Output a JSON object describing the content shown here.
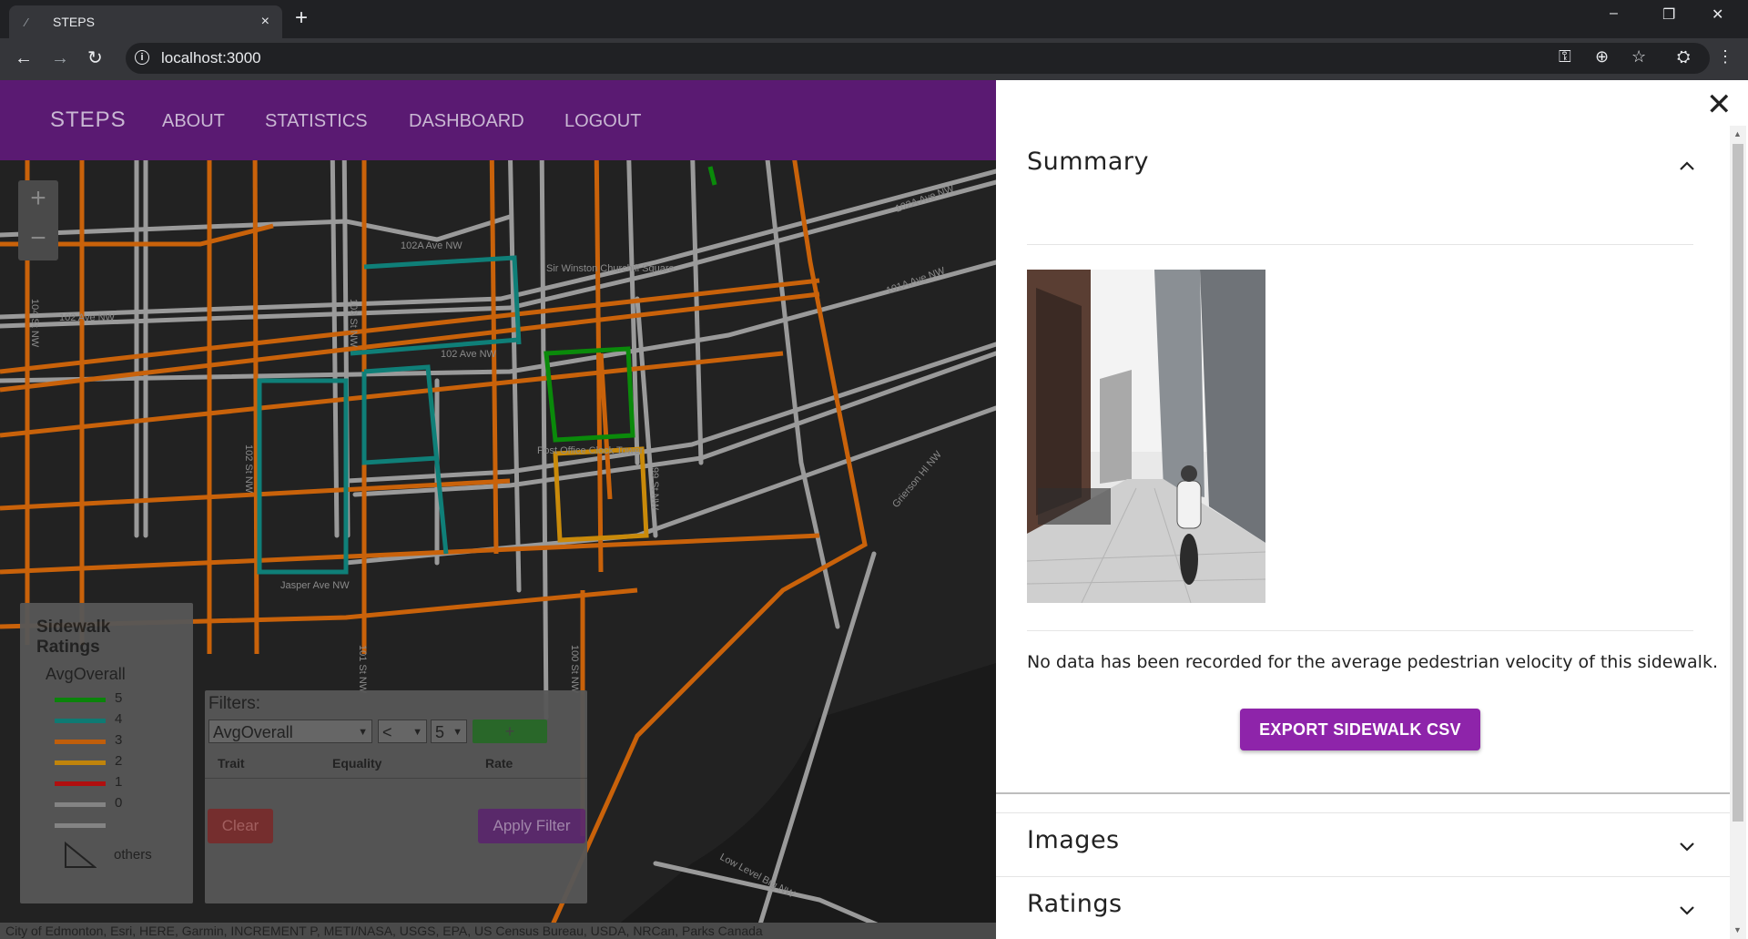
{
  "browser": {
    "tab_title": "STEPS",
    "tab_close": "×",
    "new_tab": "+",
    "url": "localhost:3000",
    "window_controls": {
      "minimize": "–",
      "restore": "❐",
      "close": "✕"
    }
  },
  "app": {
    "brand": "STEPS",
    "nav": [
      "ABOUT",
      "STATISTICS",
      "DASHBOARD",
      "LOGOUT"
    ]
  },
  "map": {
    "zoom_in": "+",
    "zoom_out": "−",
    "street_labels": [
      "102A Ave NW",
      "102 Ave NW",
      "102 Ave NW",
      "102A Ave NW",
      "101A Ave NW",
      "Jasper Ave NW",
      "104 St NW",
      "103 St NW",
      "102 St NW",
      "101 St NW",
      "100 St NW",
      "99 St NW",
      "Grierson Hl NW",
      "Low Level Brg NW",
      "Sir Winston Churchill Square",
      "Post Office Clock Tower"
    ],
    "attribution": "City of Edmonton, Esri, HERE, Garmin, INCREMENT P, METI/NASA, USGS, EPA, US Census Bureau, USDA, NRCan, Parks Canada"
  },
  "legend": {
    "title": "Sidewalk Ratings",
    "subtitle": "AvgOverall",
    "items": [
      {
        "label": "5",
        "color": "#0a8a0a"
      },
      {
        "label": "4",
        "color": "#0f7f78"
      },
      {
        "label": "3",
        "color": "#c9620a"
      },
      {
        "label": "2",
        "color": "#c98a0a"
      },
      {
        "label": "1",
        "color": "#b80f0f"
      },
      {
        "label": "0",
        "color": "#8a8a8a"
      },
      {
        "label": "",
        "color": "#8a8a8a"
      }
    ],
    "others_label": "others"
  },
  "filters": {
    "title": "Filters:",
    "trait_value": "AvgOverall",
    "equality_value": "<",
    "rate_value": "5",
    "add_label": "+",
    "columns": [
      "Trait",
      "Equality",
      "Rate"
    ],
    "clear_label": "Clear",
    "apply_label": "Apply Filter"
  },
  "panel": {
    "close": "✕",
    "summary_title": "Summary",
    "summary_chevron": "^",
    "velocity_note": "No data has been recorded for the average pedestrian velocity of this sidewalk.",
    "export_label": "EXPORT SIDEWALK CSV",
    "images_title": "Images",
    "ratings_title": "Ratings",
    "chevron_down": "⌄"
  },
  "colors": {
    "navbar": "#5a1a72",
    "export_button": "#8e24aa",
    "rating_5": "#0a8a0a",
    "rating_4": "#0f7f78",
    "rating_3": "#c9620a",
    "rating_2": "#c98a0a"
  }
}
